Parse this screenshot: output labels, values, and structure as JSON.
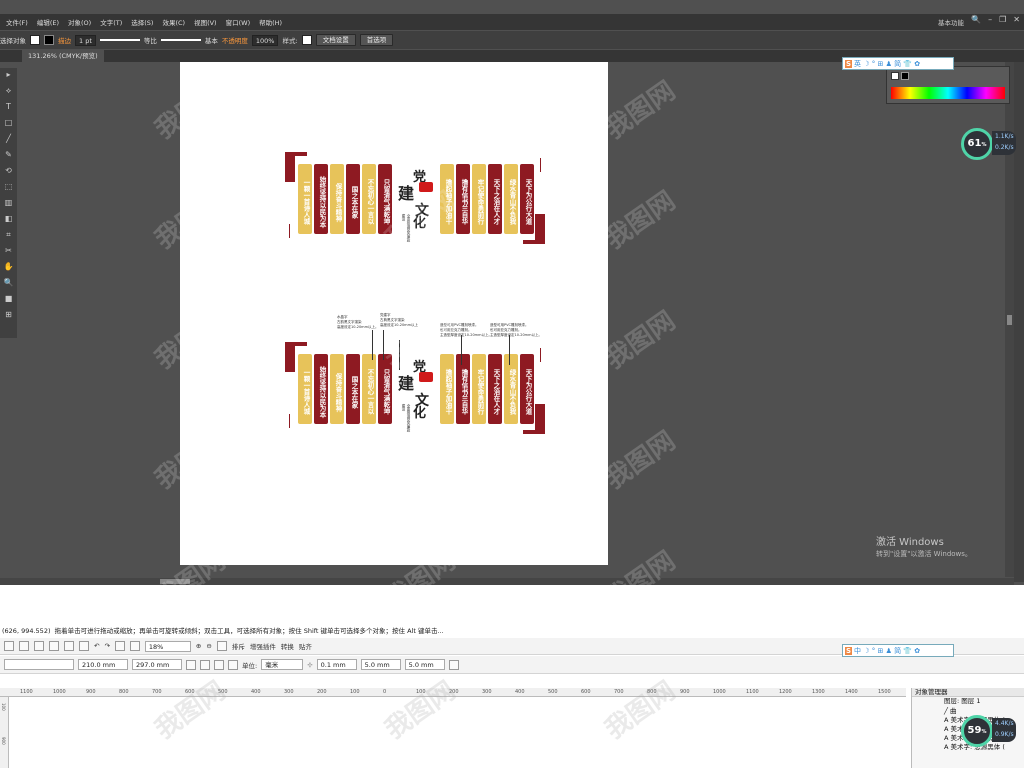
{
  "illustrator": {
    "menu": [
      "文件(F)",
      "编辑(E)",
      "对象(O)",
      "文字(T)",
      "选择(S)",
      "效果(C)",
      "视图(V)",
      "窗口(W)",
      "帮助(H)"
    ],
    "workspace": "基本功能",
    "control": {
      "selection_label": "选择对象",
      "stroke_label": "描边",
      "stroke_weight": "1 pt",
      "profile": "等比",
      "brush": "基本",
      "opacity_label": "不透明度",
      "opacity_value": "100%",
      "style_label": "样式:",
      "doc_setup": "文档设置",
      "preferences": "首选项"
    },
    "doc_tab": "131.26% (CMYK/预览)",
    "tools": [
      "▸",
      "⟡",
      "T",
      "□",
      "╱",
      "✎",
      "⟲",
      "⬚",
      "▥",
      "◧",
      "⌗",
      "✂",
      "✋",
      "🔍",
      "■",
      "⊞"
    ],
    "activate": {
      "title": "激活 Windows",
      "subtitle": "转到\"设置\"以激活 Windows。"
    },
    "perf": {
      "percent": "61",
      "unit": "%",
      "up": "1.1K/s",
      "down": "0.2K/s"
    },
    "ime": {
      "lang": "英",
      "symbols": "☽ ° ⊞ ♟ 简 👕 ✿"
    }
  },
  "design": {
    "title_chars": [
      "党",
      "建",
      "文",
      "化"
    ],
    "subtitle": "全面推进党风廉政建设",
    "left_pillars": [
      {
        "text": "一颗一首诗人城",
        "color": "yellow"
      },
      {
        "text": "始终坚持以民为本",
        "color": "red"
      },
      {
        "text": "保持奋斗精神",
        "color": "yellow"
      },
      {
        "text": "国之本在家",
        "color": "red"
      },
      {
        "text": "不忘初心一言以",
        "color": "yellow"
      },
      {
        "text": "只留清气满乾坤",
        "color": "red"
      }
    ],
    "right_pillars": [
      {
        "text": "撸起袖子加油干",
        "color": "yellow"
      },
      {
        "text": "撸有信书兰自华",
        "color": "red"
      },
      {
        "text": "牢记使命勇前行",
        "color": "yellow"
      },
      {
        "text": "天下之治在人才",
        "color": "red"
      },
      {
        "text": "绿水青山不负我",
        "color": "yellow"
      },
      {
        "text": "天下为公行大道",
        "color": "red"
      }
    ],
    "annotations": {
      "left_block": [
        "水晶字",
        "古韵黑文字渲染",
        "高度设定10-20mm以上。"
      ],
      "mid_block": [
        "党建字",
        "古典黑文字渲染",
        "高度设定10-20mm以上"
      ],
      "right_block_1": [
        "造型可用PVC雕刻喷漆。",
        "也可用亚克力雕刻。",
        "主造型厚度设定10-20mm以上。"
      ],
      "right_block_2": [
        "造型可用PVC雕刻喷漆。",
        "也可用亚克力雕刻。",
        "主造型厚度设定10-20mm以上。"
      ]
    }
  },
  "coreldraw": {
    "status_coords": "(626, 994.552)",
    "status_hint": "拖着单击可进行拖动或缩放；再单击可旋转或倾斜；双击工具，可选择所有对象；按住 Shift 键单击可选择多个对象；按住 Alt 键单击...",
    "zoom": "18%",
    "toolbar_labels": [
      "排斥",
      "增强插件",
      "转换",
      "贴齐"
    ],
    "width": "210.0 mm",
    "height": "297.0 mm",
    "unit_label": "单位:",
    "unit": "毫米",
    "nudge": "0.1 mm",
    "dup_x": "5.0 mm",
    "dup_y": "5.0 mm",
    "ruler_ticks": [
      "1100",
      "1000",
      "900",
      "800",
      "700",
      "600",
      "500",
      "400",
      "300",
      "200",
      "100",
      "0",
      "100",
      "200",
      "300",
      "400",
      "500",
      "600",
      "700",
      "800",
      "900",
      "1000",
      "1100",
      "1200",
      "1300",
      "1400",
      "1500"
    ],
    "vruler_ticks": [
      "100",
      "900"
    ],
    "object_manager": {
      "title": "对象管理器",
      "layers": [
        "图层:",
        "图层 1"
      ],
      "rows": [
        "曲",
        "美术字: 思源黑体 (",
        "美术字: 思源黑体 (",
        "美术字: 思源黑体 (",
        "美术字: 思源黑体 ("
      ]
    },
    "perf": {
      "percent": "59",
      "unit": "%",
      "up": "4.4K/s",
      "down": "0.9K/s"
    },
    "ime": {
      "lang": "中",
      "symbols": "☽ ° ⊞ ♟ 简 👕 ✿"
    }
  },
  "watermark": "我图网"
}
